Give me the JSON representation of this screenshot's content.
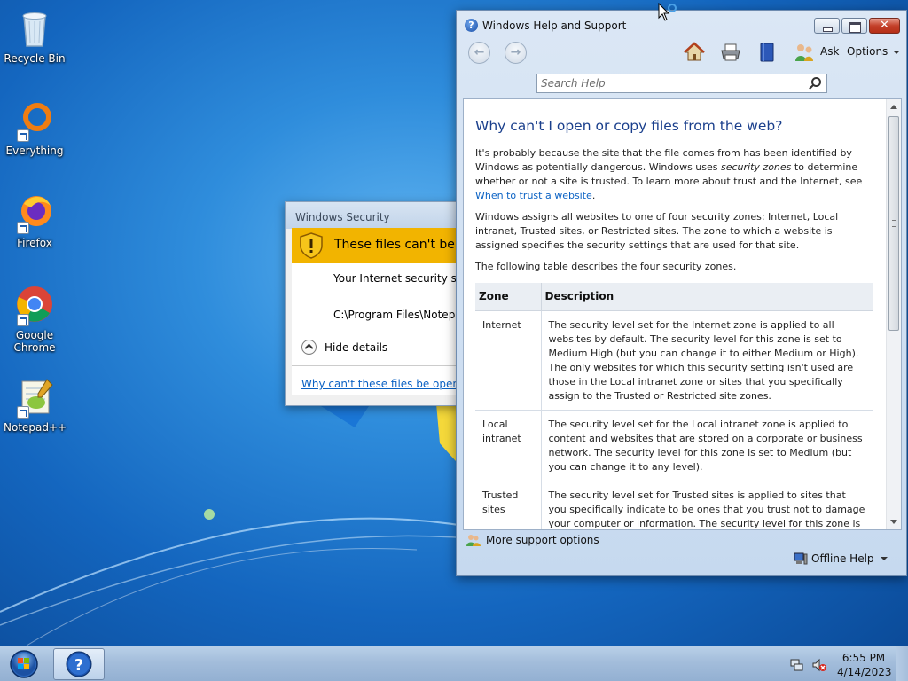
{
  "desktop": {
    "icons": [
      {
        "label": "Recycle Bin",
        "icon": "recycle-bin-icon"
      },
      {
        "label": "Everything",
        "icon": "everything-icon"
      },
      {
        "label": "Firefox",
        "icon": "firefox-icon"
      },
      {
        "label": "Google Chrome",
        "icon": "chrome-icon"
      },
      {
        "label": "Notepad++",
        "icon": "notepad-plus-plus-icon"
      }
    ]
  },
  "security_dialog": {
    "title": "Windows Security",
    "banner": "These files can't be opened",
    "message": "Your Internet security settings prevented one or more files from being opened.",
    "path": "C:\\Program Files\\Notepad++",
    "hide_details": "Hide details",
    "help_link": "Why can't these files be opened?"
  },
  "help_window": {
    "title": "Windows Help and Support",
    "toolbar": {
      "ask": "Ask",
      "options": "Options"
    },
    "search": {
      "placeholder": "Search Help"
    },
    "article": {
      "heading": "Why can't I open or copy files from the web?",
      "p1_a": "It's probably because the site that the file comes from has been identified by Windows as potentially dangerous. Windows uses ",
      "p1_em": "security zones",
      "p1_b": " to determine whether or not a site is trusted. To learn more about trust and the Internet, see ",
      "p1_link": "When to trust a website",
      "p1_c": ".",
      "p2": "Windows assigns all websites to one of four security zones: Internet, Local intranet, Trusted sites, or Restricted sites. The zone to which a website is assigned specifies the security settings that are used for that site.",
      "p3": "The following table describes the four security zones.",
      "table": {
        "headers": [
          "Zone",
          "Description"
        ],
        "rows": [
          {
            "zone": "Internet",
            "description": "The security level set for the Internet zone is applied to all websites by default. The security level for this zone is set to Medium High (but you can change it to either Medium or High). The only websites for which this security setting isn't used are those in the Local intranet zone or sites that you specifically assign to the Trusted or Restricted site zones."
          },
          {
            "zone": "Local intranet",
            "description": "The security level set for the Local intranet zone is applied to content and websites that are stored on a corporate or business network. The security level for this zone is set to Medium (but you can change it to any level)."
          },
          {
            "zone": "Trusted sites",
            "description": "The security level set for Trusted sites is applied to sites that you specifically indicate to be ones that you trust not to damage your computer or information. The security level for this zone is set to"
          }
        ]
      }
    },
    "more_support": "More support options",
    "offline_help": "Offline Help"
  },
  "taskbar": {
    "time": "6:55 PM",
    "date": "4/14/2023"
  }
}
